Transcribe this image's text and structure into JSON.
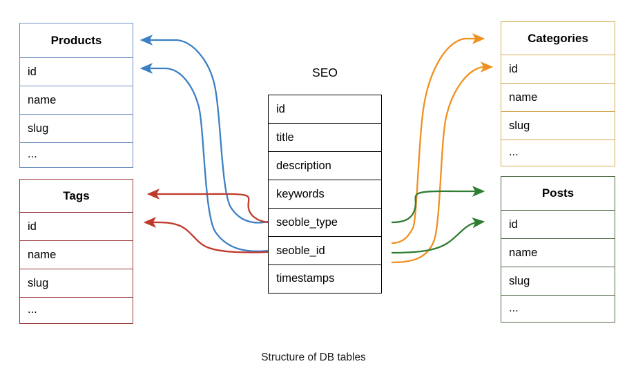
{
  "diagram": {
    "caption": "Structure of DB tables",
    "colors": {
      "products": "#6c8ebf",
      "tags": "#993333",
      "categories": "#d6a84e",
      "posts": "#4a6741",
      "seo": "#000000",
      "arrow_blue": "#3d7fc4",
      "arrow_red": "#c0392b",
      "arrow_orange": "#f0901e",
      "arrow_green": "#2e7d32"
    }
  },
  "tables": {
    "products": {
      "title": "Products",
      "columns": [
        "id",
        "name",
        "slug",
        "..."
      ]
    },
    "tags": {
      "title": "Tags",
      "columns": [
        "id",
        "name",
        "slug",
        "..."
      ]
    },
    "seo": {
      "title": "SEO",
      "columns": [
        "id",
        "title",
        "description",
        "keywords",
        "seoble_type",
        "seoble_id",
        "timestamps"
      ]
    },
    "categories": {
      "title": "Categories",
      "columns": [
        "id",
        "name",
        "slug",
        "..."
      ]
    },
    "posts": {
      "title": "Posts",
      "columns": [
        "id",
        "name",
        "slug",
        "..."
      ]
    }
  },
  "relations": [
    {
      "name": "seo-to-products-title",
      "from": "seo.seoble_type",
      "to": "products.title",
      "color": "#3d7fc4"
    },
    {
      "name": "seo-to-products-id",
      "from": "seo.seoble_id",
      "to": "products.id",
      "color": "#3d7fc4"
    },
    {
      "name": "seo-to-tags-title",
      "from": "seo.seoble_type",
      "to": "tags.title",
      "color": "#c0392b"
    },
    {
      "name": "seo-to-tags-id",
      "from": "seo.seoble_id",
      "to": "tags.id",
      "color": "#c0392b"
    },
    {
      "name": "seo-to-categories-title",
      "from": "seo.seoble_type",
      "to": "categories.title",
      "color": "#f0901e"
    },
    {
      "name": "seo-to-categories-id",
      "from": "seo.seoble_id",
      "to": "categories.id",
      "color": "#f0901e"
    },
    {
      "name": "seo-to-posts-title",
      "from": "seo.seoble_type",
      "to": "posts.title",
      "color": "#2e7d32"
    },
    {
      "name": "seo-to-posts-id",
      "from": "seo.seoble_id",
      "to": "posts.id",
      "color": "#2e7d32"
    }
  ]
}
